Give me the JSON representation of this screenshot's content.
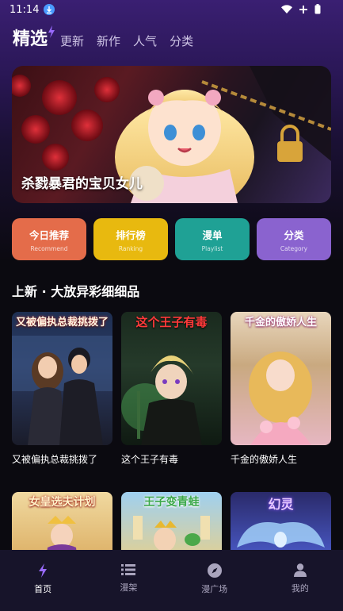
{
  "status_bar": {
    "time": "11:14"
  },
  "tabs": [
    {
      "label": "精选",
      "active": true
    },
    {
      "label": "更新",
      "active": false
    },
    {
      "label": "新作",
      "active": false
    },
    {
      "label": "人气",
      "active": false
    },
    {
      "label": "分类",
      "active": false
    }
  ],
  "banner": {
    "title": "杀戮暴君的宝贝女儿"
  },
  "quick_actions": [
    {
      "label": "今日推荐",
      "sub": "Recommend",
      "color": "#e46c4a"
    },
    {
      "label": "排行榜",
      "sub": "Ranking",
      "color": "#e8b90f"
    },
    {
      "label": "漫单",
      "sub": "Playlist",
      "color": "#1fa195"
    },
    {
      "label": "分类",
      "sub": "Category",
      "color": "#8a63cf"
    }
  ],
  "section": {
    "title": "上新 · 大放异彩细细品"
  },
  "comics": [
    {
      "cover_title": "又被偏执总裁挑拨了",
      "name": "又被偏执总裁挑拨了"
    },
    {
      "cover_title": "这个王子有毒",
      "name": "这个王子有毒"
    },
    {
      "cover_title": "千金的傲娇人生",
      "name": "千金的傲娇人生"
    },
    {
      "cover_title": "女皇选夫计划",
      "name": ""
    },
    {
      "cover_title": "王子变青蛙",
      "name": ""
    },
    {
      "cover_title": "幻灵",
      "name": ""
    }
  ],
  "bottom_nav": [
    {
      "label": "首页",
      "icon": "lightning-icon",
      "active": true
    },
    {
      "label": "漫架",
      "icon": "shelf-icon",
      "active": false
    },
    {
      "label": "漫广场",
      "icon": "compass-icon",
      "active": false
    },
    {
      "label": "我的",
      "icon": "person-icon",
      "active": false
    }
  ],
  "colors": {
    "accent": "#8f6bff",
    "background": "#0b0a10",
    "nav": "#17142a"
  }
}
